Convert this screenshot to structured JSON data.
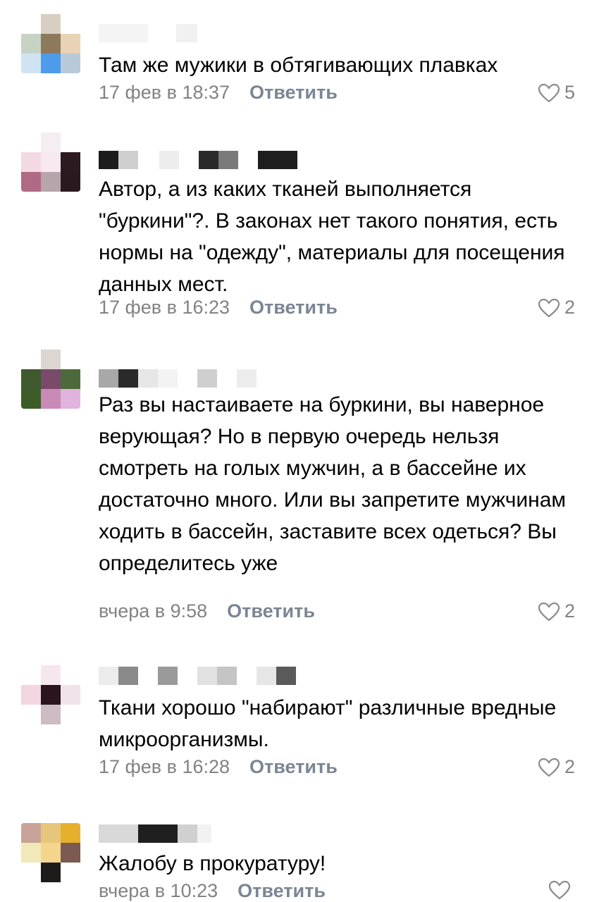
{
  "comments": [
    {
      "text": "Там же мужики в обтягивающих плавках",
      "date": "17 фев в 18:37",
      "reply": "Ответить",
      "likes": "5",
      "avatar_colors": [
        "#ffffff",
        "#d8cfc2",
        "#ffffff",
        "#c7d3c2",
        "#8d7a5c",
        "#e8d3b6",
        "#cfe4f3",
        "#4d9bea",
        "#b9c9d9"
      ]
    },
    {
      "text": "Автор, а из каких тканей выполняется \"буркини\"?.  В законах нет такого понятия, есть нормы на \"одежду\", материалы для посещения данных мест.",
      "date": "17 фев в 16:23",
      "reply": "Ответить",
      "likes": "2",
      "avatar_colors": [
        "#ffffff",
        "#f4eef2",
        "#ffffff",
        "#f3d9e3",
        "#f8e8f0",
        "#2b1a20",
        "#b06a86",
        "#b7a4ad",
        "#2a1a1f"
      ]
    },
    {
      "text": "Раз вы настаиваете на буркини, вы наверное верующая? Но в первую очередь нельзя смотреть на голых мужчин, а в бассейне их достаточно много. Или вы запретите мужчинам ходить в бассейн, заставите всех одеться? Вы определитесь уже",
      "date": "вчера в 9:58",
      "reply": "Ответить",
      "likes": "2",
      "avatar_colors": [
        "#ffffff",
        "#dcd6d2",
        "#ffffff",
        "#3e5a2e",
        "#7a4a6a",
        "#4d6a3c",
        "#3c5c28",
        "#c98ab8",
        "#e0b4dc"
      ]
    },
    {
      "text": "Ткани хорошо \"набирают\" различные вредные микроорганизмы.",
      "date": "17 фев в 16:28",
      "reply": "Ответить",
      "likes": "2",
      "avatar_colors": [
        "#ffffff",
        "#f6e6ee",
        "#ffffff",
        "#f3d6e2",
        "#2a1420",
        "#f1e3ea",
        "#ffffff",
        "#cdbcc4",
        "#ffffff"
      ]
    },
    {
      "text": "Жалобу в прокуратуру!",
      "date": "вчера в 10:23",
      "reply": "Ответить",
      "likes": "",
      "avatar_colors": [
        "#c8a39a",
        "#e6c67a",
        "#e6b02a",
        "#f2e9b8",
        "#f3d58e",
        "#7a5a52",
        "#ffffff",
        "#1e1c1a",
        "#ffffff"
      ]
    }
  ]
}
